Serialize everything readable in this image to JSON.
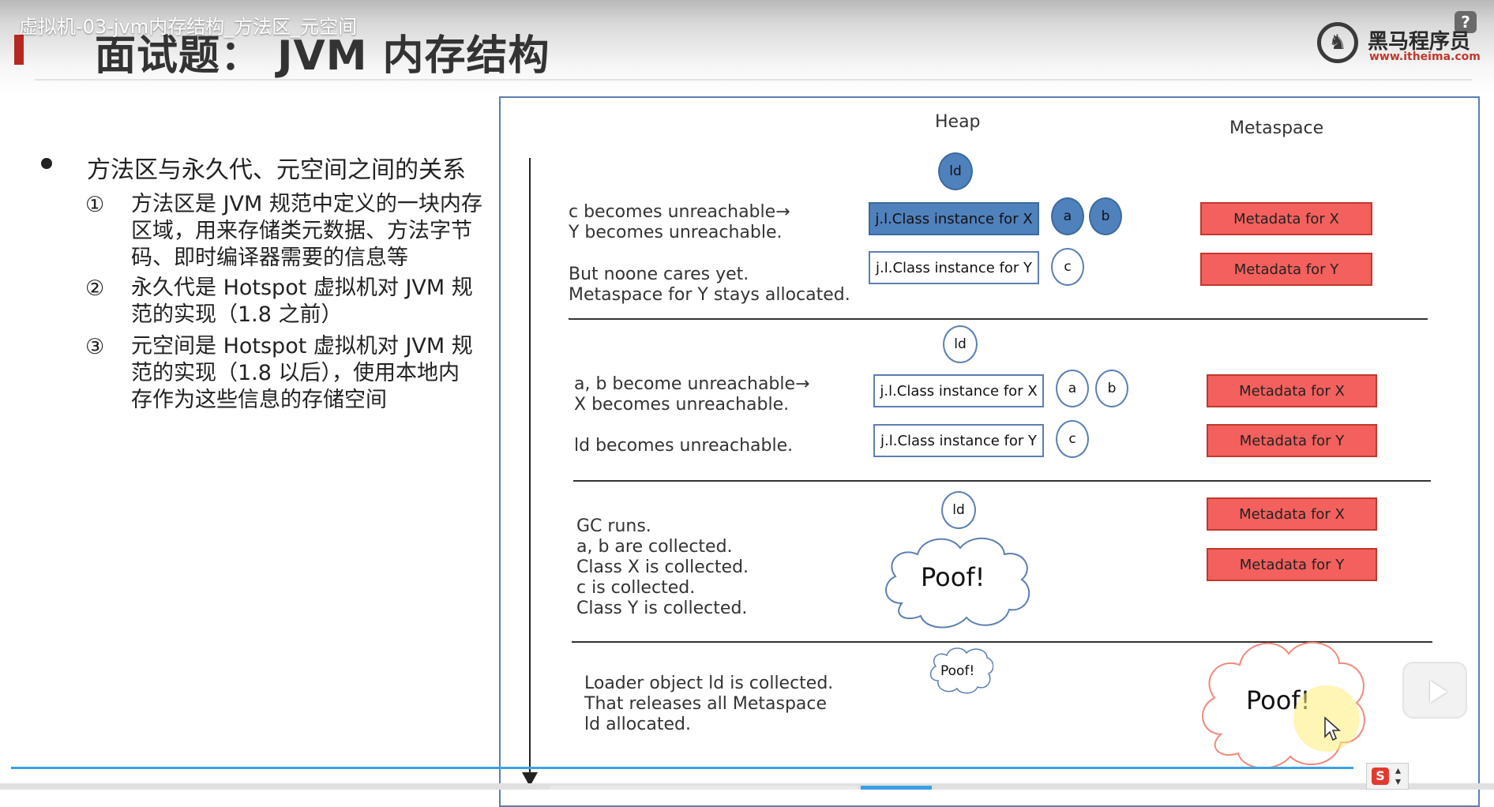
{
  "window": {
    "video_title": "虚拟机-03-jvm内存结构_方法区_元空间",
    "help": "?"
  },
  "slide": {
    "title": "面试题： JVM 内存结构",
    "logo": {
      "name": "黑马程序员",
      "url": "www.itheima.com"
    },
    "bullet": "方法区与永久代、元空间之间的关系",
    "items": [
      {
        "num": "①",
        "lines": [
          "方法区是 JVM 规范中定义的一块内存",
          "区域，用来存储类元数据、方法字节",
          "码、即时编译器需要的信息等"
        ]
      },
      {
        "num": "②",
        "lines": [
          "永久代是 Hotspot 虚拟机对 JVM 规",
          "范的实现（1.8 之前）"
        ]
      },
      {
        "num": "③",
        "lines": [
          "元空间是 Hotspot 虚拟机对 JVM 规",
          "范的实现（1.8 以后），使用本地内",
          "存作为这些信息的存储空间"
        ]
      }
    ]
  },
  "diagram": {
    "heap_label": "Heap",
    "metaspace_label": "Metaspace",
    "stage1": {
      "ld": "ld",
      "class_x": "j.l.Class instance for X",
      "class_y": "j.l.Class instance for Y",
      "a": "a",
      "b": "b",
      "c": "c",
      "meta_x": "Metadata for X",
      "meta_y": "Metadata for Y",
      "desc1": [
        "c becomes unreachable→",
        "Y becomes unreachable."
      ],
      "desc2": [
        "But noone cares yet.",
        "Metaspace for Y stays allocated."
      ]
    },
    "stage2": {
      "ld": "ld",
      "class_x": "j.l.Class instance for X",
      "class_y": "j.l.Class instance for Y",
      "a": "a",
      "b": "b",
      "c": "c",
      "meta_x": "Metadata for X",
      "meta_y": "Metadata for Y",
      "desc1": [
        "a, b become unreachable→",
        "X becomes unreachable."
      ],
      "desc2": [
        "ld becomes unreachable."
      ]
    },
    "stage3": {
      "ld": "ld",
      "poof": "Poof!",
      "meta_x": "Metadata for X",
      "meta_y": "Metadata for Y",
      "desc": [
        "GC runs.",
        "a, b are collected.",
        "Class X is collected.",
        "c  is collected.",
        "Class Y is collected."
      ]
    },
    "stage4": {
      "poof_small": "Poof!",
      "poof_big": "Poof!",
      "desc": [
        "Loader object ld is collected.",
        "That releases all Metaspace",
        "ld allocated."
      ]
    }
  },
  "player": {
    "ime_label": "S"
  },
  "colors": {
    "heap_blue": "#4f81bd",
    "metadata_red": "#f4605d",
    "frame_blue": "#5b7fb3",
    "accent_red": "#b5281f",
    "progress_blue": "#3aa0e4"
  }
}
